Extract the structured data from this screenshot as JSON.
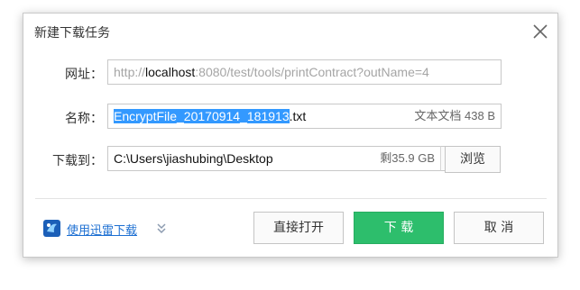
{
  "dialog": {
    "title": "新建下载任务",
    "url_label": "网址：",
    "url_scheme": "http://",
    "url_host": "localhost",
    "url_path": ":8080/test/tools/printContract?outName=4",
    "name_label": "名称：",
    "name_selected": "EncryptFile_20170914_181913",
    "name_ext": ".txt",
    "file_type_size": "文本文档 438 B",
    "saveto_label": "下载到：",
    "saveto_path": "C:\\Users\\jiashubing\\Desktop",
    "free_space": "剩35.9 GB",
    "browse_label": "浏览",
    "xunlei_link": "使用迅雷下载",
    "open_label": "直接打开",
    "download_label": "下 载",
    "cancel_label": "取 消"
  },
  "colors": {
    "accent_green": "#2dbe6c",
    "selection": "#3399ff",
    "link": "#1c6fd2"
  },
  "icons": [
    "close-icon",
    "dropdown-arrow-icon",
    "xunlei-icon",
    "double-chevron-down-icon"
  ]
}
